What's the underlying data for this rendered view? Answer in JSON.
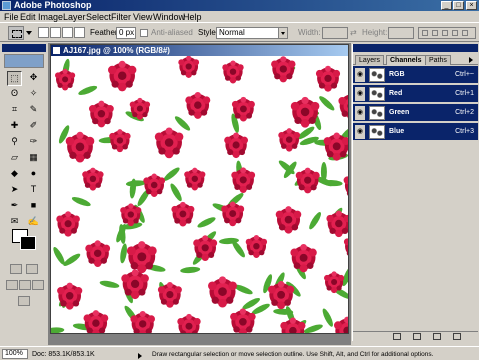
{
  "window": {
    "title": "Adobe Photoshop",
    "buttons": [
      "_",
      "□",
      "×"
    ]
  },
  "menu": {
    "items": [
      "File",
      "Edit",
      "Image",
      "Layer",
      "Select",
      "Filter",
      "View",
      "Window",
      "Help"
    ]
  },
  "options": {
    "feather_label": "Feather:",
    "feather_value": "0 px",
    "antialiased_label": "Anti-aliased",
    "style_label": "Style:",
    "style_value": "Normal",
    "width_label": "Width:",
    "height_label": "Height:"
  },
  "document": {
    "title": "AJ167.jpg @ 100% (RGB/8#)"
  },
  "panel": {
    "tabs": [
      "Layers",
      "Channels",
      "Paths"
    ],
    "active_tab": "Channels",
    "channels": [
      {
        "name": "RGB",
        "shortcut": "Ctrl+~"
      },
      {
        "name": "Red",
        "shortcut": "Ctrl+1"
      },
      {
        "name": "Green",
        "shortcut": "Ctrl+2"
      },
      {
        "name": "Blue",
        "shortcut": "Ctrl+3"
      }
    ]
  },
  "status": {
    "zoom": "100%",
    "doc": "Doc: 853.1K/853.1K",
    "message": "Draw rectangular selection or move selection outline.  Use Shift, Alt, and Ctrl for additional options."
  },
  "colors": {
    "title_blue": "#0a246a",
    "flower_red": "#c8103c",
    "leaf_green": "#4ca832",
    "chrome_gray": "#d4d0c8"
  }
}
